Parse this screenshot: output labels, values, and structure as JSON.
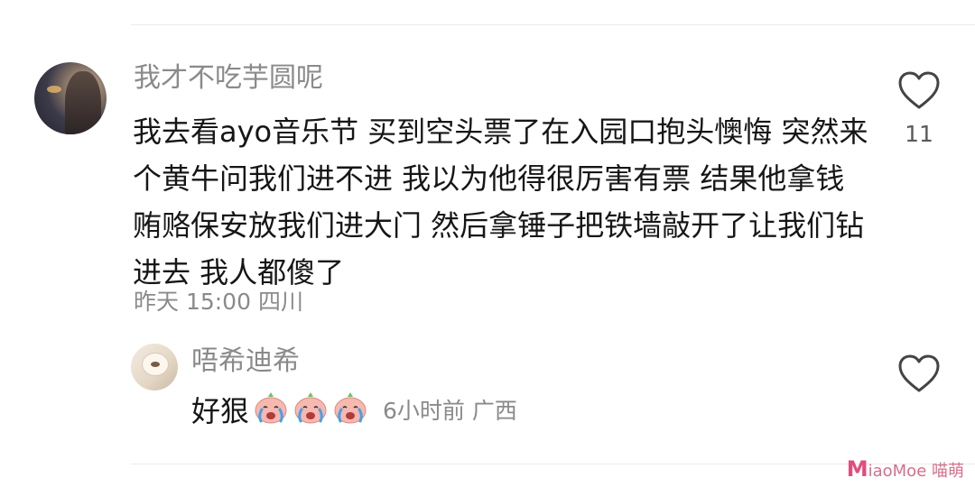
{
  "comment": {
    "username": "我才不吃芋圆呢",
    "text": "我去看ayo音乐节 买到空头票了在入园口抱头懊悔 突然来个黄牛问我们进不进 我以为他得很厉害有票 结果他拿钱贿赂保安放我们进大门 然后拿锤子把铁墙敲开了让我们钻进去 我人都傻了",
    "meta": "昨天 15:00 四川",
    "like_icon": "heart-outline-icon",
    "like_count": "11"
  },
  "reply": {
    "username": "唔希迪希",
    "text": "好狠",
    "emoji_icon": "crying-face-emoji",
    "emoji_count": 3,
    "meta": "6小时前  广西",
    "like_icon": "heart-outline-icon"
  },
  "watermark": {
    "text_big": "M",
    "text_rest": "iaoMoe 喵萌"
  },
  "colors": {
    "secondary_text": "#8a8a8a",
    "primary_text": "#161616",
    "divider": "#ececec",
    "watermark": "#e04d7d"
  }
}
